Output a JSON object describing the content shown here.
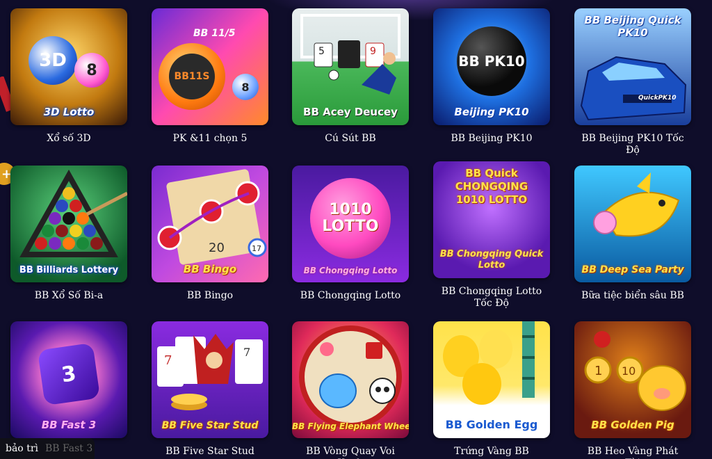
{
  "games": [
    {
      "label": "Xổ số 3D",
      "thumb_text": "3D Lotto",
      "thumb_title": "3D",
      "icon": "lotto-3d-icon",
      "bg": [
        "#3a1a08",
        "#c27a10"
      ]
    },
    {
      "label": "PK &11 chọn 5",
      "thumb_text": "BB11S",
      "thumb_title": "BB 11/5",
      "icon": "bb115-icon",
      "bg": [
        "#6a2bd6",
        "#ff8a2a"
      ]
    },
    {
      "label": "Cú Sút BB",
      "thumb_text": "BB Acey Deucey",
      "icon": "soccer-kick-icon",
      "bg": [
        "#dfe8e8",
        "#3aa84a"
      ]
    },
    {
      "label": "BB Beijing PK10",
      "thumb_text": "Beijing PK10",
      "thumb_title": "BB PK10",
      "icon": "pk10-icon",
      "bg": [
        "#0a2a8a",
        "#1e8fff"
      ]
    },
    {
      "label": "BB Beijing PK10 Tốc Độ",
      "thumb_text": "QuickPK10",
      "thumb_title": "BB Beijing Quick PK10",
      "icon": "race-car-icon",
      "bg": [
        "#1a3f9c",
        "#70b8ff"
      ]
    },
    {
      "label": "BB Xổ Số Bi-a",
      "thumb_text": "BB Billiards Lottery",
      "icon": "billiards-icon",
      "bg": [
        "#0e5a2a",
        "#3fb060"
      ]
    },
    {
      "label": "BB Bingo",
      "thumb_text": "BB Bingo",
      "icon": "bingo-card-icon",
      "bg": [
        "#7a2bd0",
        "#ff6ab0"
      ]
    },
    {
      "label": "BB Chongqing Lotto",
      "thumb_text": "BB Chongqing Lotto",
      "thumb_title": "1010 LOTTO",
      "icon": "chongqing-lotto-icon",
      "bg": [
        "#4a1aa0",
        "#ff5ac8"
      ]
    },
    {
      "label": "BB Chongqing Lotto Tốc Độ",
      "thumb_text": "BB Chongqing Quick Lotto",
      "thumb_title": "BB Quick CHONGQING 1010 LOTTO",
      "icon": "quick-lotto-icon",
      "bg": [
        "#5a1ab0",
        "#d050ff"
      ]
    },
    {
      "label": "Bữa tiệc biển sâu BB",
      "thumb_text": "BB Deep Sea Party",
      "icon": "shark-icon",
      "bg": [
        "#0a5aa0",
        "#40c8ff"
      ]
    },
    {
      "label": "BB Fast 3",
      "thumb_text": "BB Fast 3",
      "icon": "dice-icon",
      "bg": [
        "#3a1a9c",
        "#ff7ad0"
      ]
    },
    {
      "label": "BB Five Star Stud",
      "thumb_text": "BB Five Star Stud",
      "icon": "joker-card-icon",
      "bg": [
        "#4a1aa0",
        "#8a2be0"
      ]
    },
    {
      "label": "BB Vòng Quay Voi Xanh",
      "thumb_text": "BB Flying Elephant Wheel",
      "icon": "elephant-wheel-icon",
      "bg": [
        "#c01a5a",
        "#ff9a2a"
      ]
    },
    {
      "label": "Trứng Vàng BB",
      "thumb_text": "BB Golden Egg",
      "icon": "golden-egg-icon",
      "bg": [
        "#ffe86a",
        "#ffffff"
      ]
    },
    {
      "label": "BB Heo Vàng Phát Tài",
      "thumb_text": "BB Golden Pig",
      "icon": "golden-pig-icon",
      "bg": [
        "#6a1a10",
        "#e0801a"
      ]
    }
  ],
  "maintenance": {
    "status": "bảo trì",
    "game": "BB Fast 3"
  }
}
